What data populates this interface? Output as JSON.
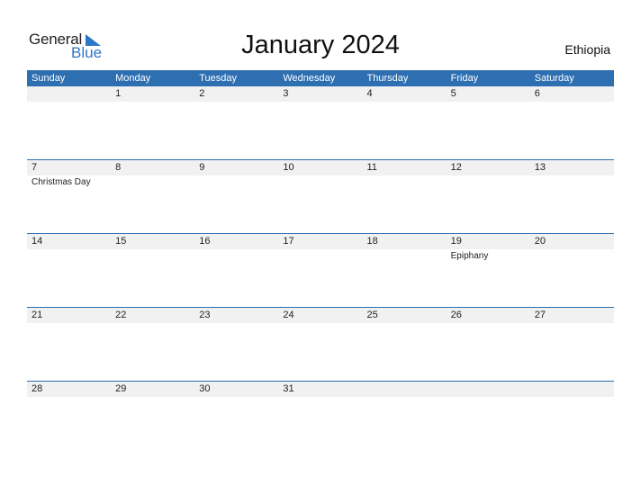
{
  "logo": {
    "line1": "General",
    "line2": "Blue",
    "brand_color": "#2b77c5"
  },
  "title": "January 2024",
  "country": "Ethiopia",
  "header_color": "#2e6fb2",
  "days": [
    "Sunday",
    "Monday",
    "Tuesday",
    "Wednesday",
    "Thursday",
    "Friday",
    "Saturday"
  ],
  "weeks": [
    {
      "dates": [
        "",
        "1",
        "2",
        "3",
        "4",
        "5",
        "6"
      ],
      "events": [
        "",
        "",
        "",
        "",
        "",
        "",
        ""
      ]
    },
    {
      "dates": [
        "7",
        "8",
        "9",
        "10",
        "11",
        "12",
        "13"
      ],
      "events": [
        "Christmas Day",
        "",
        "",
        "",
        "",
        "",
        ""
      ]
    },
    {
      "dates": [
        "14",
        "15",
        "16",
        "17",
        "18",
        "19",
        "20"
      ],
      "events": [
        "",
        "",
        "",
        "",
        "",
        "Epiphany",
        ""
      ]
    },
    {
      "dates": [
        "21",
        "22",
        "23",
        "24",
        "25",
        "26",
        "27"
      ],
      "events": [
        "",
        "",
        "",
        "",
        "",
        "",
        ""
      ]
    },
    {
      "dates": [
        "28",
        "29",
        "30",
        "31",
        "",
        "",
        ""
      ],
      "events": [
        "",
        "",
        "",
        "",
        "",
        "",
        ""
      ]
    }
  ]
}
